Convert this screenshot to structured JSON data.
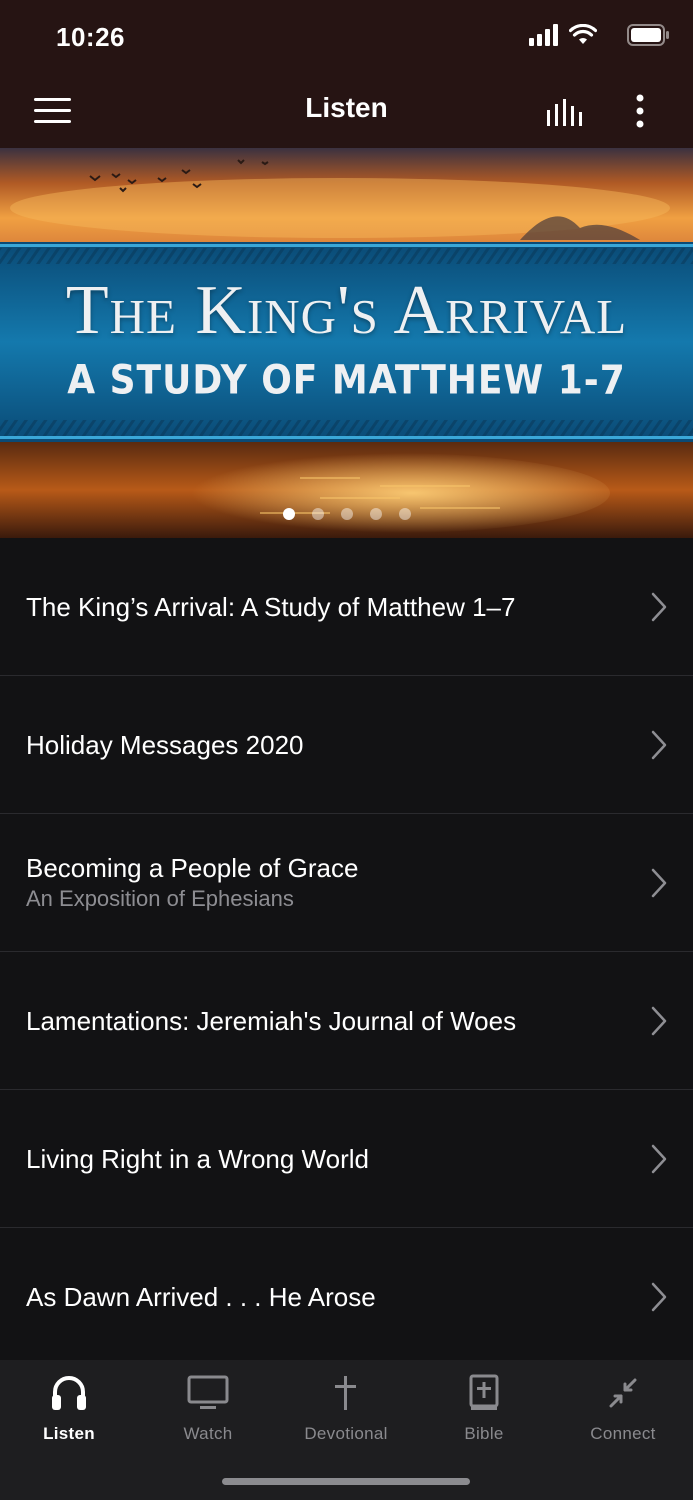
{
  "status_bar": {
    "time": "10:26"
  },
  "header": {
    "title": "Listen"
  },
  "banner": {
    "line1": "The King's Arrival",
    "line2": "A STUDY OF MATTHEW 1-7",
    "page_count": 5,
    "active_page": 1
  },
  "series": [
    {
      "title": "The King’s Arrival: A Study of Matthew 1–7",
      "subtitle": ""
    },
    {
      "title": "Holiday Messages 2020",
      "subtitle": ""
    },
    {
      "title": "Becoming a People of Grace",
      "subtitle": "An Exposition of Ephesians"
    },
    {
      "title": "Lamentations: Jeremiah's Journal of Woes",
      "subtitle": ""
    },
    {
      "title": "Living Right in a Wrong World",
      "subtitle": ""
    },
    {
      "title": "As Dawn Arrived . . . He Arose",
      "subtitle": ""
    }
  ],
  "tabs": [
    {
      "label": "Listen",
      "icon": "headphones-icon",
      "active": true
    },
    {
      "label": "Watch",
      "icon": "monitor-icon",
      "active": false
    },
    {
      "label": "Devotional",
      "icon": "cross-icon",
      "active": false
    },
    {
      "label": "Bible",
      "icon": "bible-icon",
      "active": false
    },
    {
      "label": "Connect",
      "icon": "connect-icon",
      "active": false
    }
  ],
  "colors": {
    "header_bg": "#261413",
    "list_bg": "#121214",
    "tabbar_bg": "#1e1e20",
    "banner_band": "#0c5f8e"
  }
}
